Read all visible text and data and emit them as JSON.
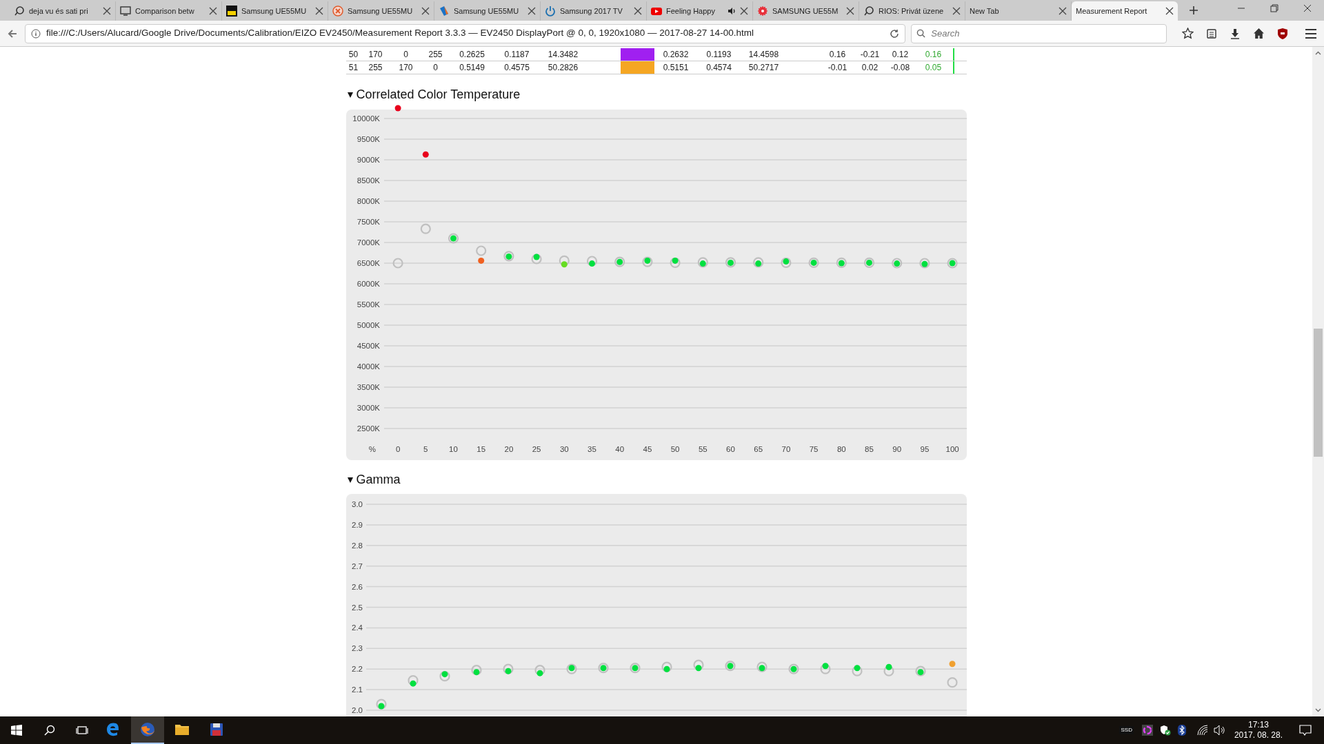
{
  "tabs": [
    {
      "title": "deja vu és sati pri",
      "selected": false,
      "playing_audio": false
    },
    {
      "title": "Comparison betw",
      "selected": false,
      "playing_audio": false
    },
    {
      "title": "Samsung UE55MU",
      "selected": false,
      "playing_audio": false
    },
    {
      "title": "Samsung UE55MU",
      "selected": false,
      "playing_audio": false
    },
    {
      "title": "Samsung UE55MU",
      "selected": false,
      "playing_audio": false
    },
    {
      "title": "Samsung 2017 TV",
      "selected": false,
      "playing_audio": false
    },
    {
      "title": "Feeling Happy",
      "selected": false,
      "playing_audio": true
    },
    {
      "title": "SAMSUNG UE55M",
      "selected": false,
      "playing_audio": false
    },
    {
      "title": "RIOS: Privát üzene",
      "selected": false,
      "playing_audio": false
    },
    {
      "title": "New Tab",
      "selected": false,
      "playing_audio": false
    },
    {
      "title": "Measurement Report",
      "selected": true,
      "playing_audio": false
    }
  ],
  "address_bar": {
    "url": "file:///C:/Users/Alucard/Google Drive/Documents/Calibration/EIZO EV2450/Measurement Report 3.3.3 — EV2450 DisplayPort @ 0, 0, 1920x1080 — 2017-08-27 14-00.html"
  },
  "search": {
    "placeholder": "Search"
  },
  "table": {
    "rows": [
      {
        "cells": [
          "50",
          "170",
          "0",
          "255",
          "0.2625",
          "0.1187",
          "14.3482",
          "0.2632",
          "0.1193",
          "14.4598",
          "0.16",
          "-0.21",
          "0.12",
          "0.16"
        ],
        "color": "#a020f0"
      },
      {
        "cells": [
          "51",
          "255",
          "170",
          "0",
          "0.5149",
          "0.4575",
          "50.2826",
          "0.5151",
          "0.4574",
          "50.2717",
          "-0.01",
          "0.02",
          "-0.08",
          "0.05"
        ],
        "color": "#f5a623"
      }
    ]
  },
  "sections": [
    {
      "title": "Correlated Color Temperature",
      "expanded": true,
      "chart_data": {
        "type": "scatter",
        "xlabel": "%",
        "grid": true,
        "x": [
          0,
          5,
          10,
          15,
          20,
          25,
          30,
          35,
          40,
          45,
          50,
          55,
          60,
          65,
          70,
          75,
          80,
          85,
          90,
          95,
          100
        ],
        "xlim": [
          -2.5,
          102.6
        ],
        "ylim": [
          2500,
          10250
        ],
        "yticks": [
          {
            "value": 10000,
            "label": "10000K"
          },
          {
            "value": 9500,
            "label": "9500K"
          },
          {
            "value": 9000,
            "label": "9000K"
          },
          {
            "value": 8500,
            "label": "8500K"
          },
          {
            "value": 8000,
            "label": "8000K"
          },
          {
            "value": 7500,
            "label": "7500K"
          },
          {
            "value": 7000,
            "label": "7000K"
          },
          {
            "value": 6500,
            "label": "6500K"
          },
          {
            "value": 6000,
            "label": "6000K"
          },
          {
            "value": 5500,
            "label": "5500K"
          },
          {
            "value": 5000,
            "label": "5000K"
          },
          {
            "value": 4500,
            "label": "4500K"
          },
          {
            "value": 4000,
            "label": "4000K"
          },
          {
            "value": 3500,
            "label": "3500K"
          },
          {
            "value": 3000,
            "label": "3000K"
          },
          {
            "value": 2500,
            "label": "2500K"
          }
        ],
        "xticks": [
          0,
          5,
          10,
          15,
          20,
          25,
          30,
          35,
          40,
          45,
          50,
          55,
          60,
          65,
          70,
          75,
          80,
          85,
          90,
          95,
          100
        ],
        "series": [
          {
            "color": "#c0c0c0",
            "values": [
              6500,
              7330,
              7100,
              6800,
              6670,
              6600,
              6560,
              6550,
              6530,
              6530,
              6510,
              6520,
              6520,
              6520,
              6510,
              6510,
              6510,
              6510,
              6500,
              6500,
              6500
            ]
          },
          {
            "color": "#e8001c",
            "values": [
              10250,
              9130,
              null,
              null,
              null,
              null,
              null,
              null,
              null,
              null,
              null,
              null,
              null,
              null,
              null,
              null,
              null,
              null,
              null,
              null,
              null
            ]
          },
          {
            "color": "#f06020",
            "values": [
              null,
              null,
              null,
              6560,
              null,
              null,
              null,
              null,
              null,
              null,
              null,
              null,
              null,
              null,
              null,
              null,
              null,
              null,
              null,
              null,
              null
            ]
          },
          {
            "color": "#66dd22",
            "values": [
              null,
              null,
              null,
              null,
              null,
              null,
              6470,
              null,
              null,
              null,
              null,
              null,
              null,
              null,
              null,
              null,
              null,
              null,
              null,
              null,
              null
            ]
          },
          {
            "color": "#00e040",
            "values": [
              null,
              null,
              7100,
              null,
              6660,
              6650,
              null,
              6490,
              6530,
              6560,
              6560,
              6490,
              6510,
              6490,
              6540,
              6510,
              6500,
              6510,
              6490,
              6480,
              6500
            ]
          }
        ]
      }
    },
    {
      "title": "Gamma",
      "expanded": true,
      "chart_data": {
        "type": "scatter",
        "grid": true,
        "ylim": [
          2.0,
          3.0
        ],
        "yticks": [
          {
            "value": 3.0,
            "label": "3.0"
          },
          {
            "value": 2.9,
            "label": "2.9"
          },
          {
            "value": 2.8,
            "label": "2.8"
          },
          {
            "value": 2.7,
            "label": "2.7"
          },
          {
            "value": 2.6,
            "label": "2.6"
          },
          {
            "value": 2.5,
            "label": "2.5"
          },
          {
            "value": 2.4,
            "label": "2.4"
          },
          {
            "value": 2.3,
            "label": "2.3"
          },
          {
            "value": 2.2,
            "label": "2.2"
          },
          {
            "value": 2.1,
            "label": "2.1"
          },
          {
            "value": 2.0,
            "label": "2.0"
          }
        ],
        "series": [
          {
            "color": "#c0c0c0",
            "values": [
              2.03,
              2.145,
              2.165,
              2.195,
              2.2,
              2.195,
              2.2,
              2.205,
              2.205,
              2.21,
              2.22,
              2.215,
              2.21,
              2.2,
              2.2,
              2.19,
              2.19,
              2.19,
              2.135
            ]
          },
          {
            "color": "#00e040",
            "values": [
              2.02,
              2.13,
              2.175,
              2.185,
              2.19,
              2.18,
              2.205,
              2.205,
              2.205,
              2.2,
              2.205,
              2.215,
              2.205,
              2.2,
              2.215,
              2.205,
              2.21,
              2.185,
              null
            ]
          },
          {
            "color": "#f0a030",
            "values": [
              null,
              null,
              null,
              null,
              null,
              null,
              null,
              null,
              null,
              null,
              null,
              null,
              null,
              null,
              null,
              null,
              null,
              null,
              2.225
            ]
          }
        ]
      }
    }
  ],
  "taskbar": {
    "apps": [
      {
        "active": false
      },
      {
        "active": true
      },
      {
        "active": false
      },
      {
        "active": false
      }
    ],
    "ssd_label": "SSD",
    "time": "17:13",
    "date": "2017. 08. 28."
  }
}
